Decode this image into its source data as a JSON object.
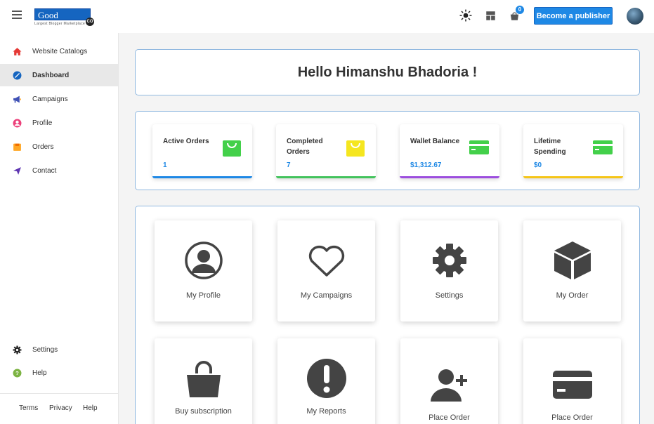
{
  "header": {
    "logo_text": "Good Blogger",
    "logo_badge": "CO",
    "logo_tagline": "Largest Blogger Marketplace",
    "cart_count": "0",
    "publisher_button": "Become a publisher",
    "icons": [
      "menu-icon",
      "sun-icon",
      "layout-icon",
      "cart-icon"
    ]
  },
  "sidebar": {
    "items": [
      {
        "label": "Website Catalogs",
        "icon": "home-icon",
        "color": "#e53935"
      },
      {
        "label": "Dashboard",
        "icon": "dashboard-icon",
        "color": "#1565c0"
      },
      {
        "label": "Campaigns",
        "icon": "megaphone-icon",
        "color": "#3f51b5"
      },
      {
        "label": "Profile",
        "icon": "user-icon",
        "color": "#ec407a"
      },
      {
        "label": "Orders",
        "icon": "orders-icon",
        "color": "#ffa726"
      },
      {
        "label": "Contact",
        "icon": "send-icon",
        "color": "#5e35b1"
      }
    ],
    "active": "Dashboard",
    "bottom_items": [
      {
        "label": "Settings",
        "icon": "gear-icon"
      },
      {
        "label": "Help",
        "icon": "help-icon",
        "color": "#7cb342"
      }
    ],
    "footer": [
      "Terms",
      "Privacy",
      "Help"
    ]
  },
  "greeting": "Hello Himanshu Bhadoria !",
  "stats": [
    {
      "label": "Active Orders",
      "value": "1",
      "icon": "shopping-bag-icon",
      "icon_color": "#43d04a",
      "bar_color": "#1e88e5"
    },
    {
      "label": "Completed Orders",
      "value": "7",
      "icon": "shopping-bag-icon",
      "icon_color": "#f5e61f",
      "bar_color": "#43c35c"
    },
    {
      "label": "Wallet Balance",
      "value": "$1,312.67",
      "icon": "credit-card-icon",
      "icon_color": "#43d04a",
      "bar_color": "#9c4dde"
    },
    {
      "label": "Lifetime Spending",
      "value": "$0",
      "icon": "credit-card-icon",
      "icon_color": "#43d04a",
      "bar_color": "#f5c518"
    }
  ],
  "tiles": [
    {
      "label": "My Profile",
      "icon": "user-circle-icon"
    },
    {
      "label": "My Campaigns",
      "icon": "heart-icon"
    },
    {
      "label": "Settings",
      "icon": "gear-icon"
    },
    {
      "label": "My Order",
      "icon": "box-icon"
    },
    {
      "label": "Buy subscription",
      "icon": "shopping-bag-icon"
    },
    {
      "label": "My Reports",
      "icon": "exclamation-circle-icon"
    },
    {
      "label": "Place Order",
      "icon": "user-plus-icon"
    },
    {
      "label": "Place Order",
      "icon": "credit-card-icon"
    }
  ]
}
